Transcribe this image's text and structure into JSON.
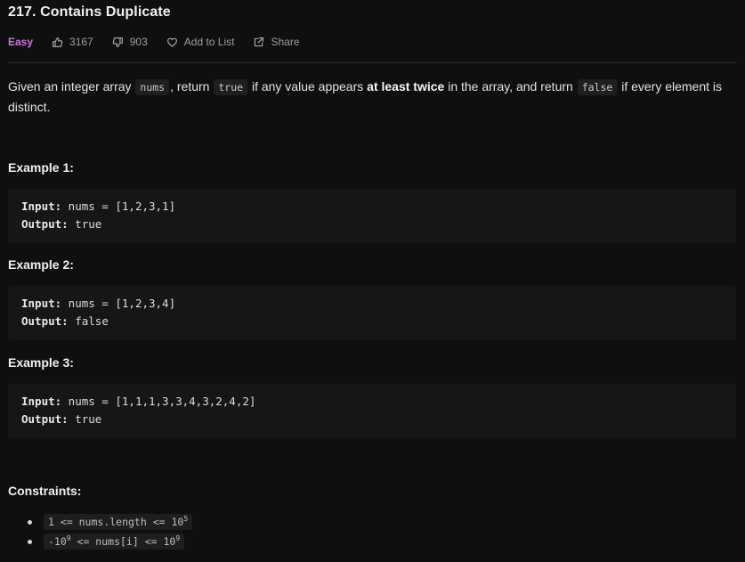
{
  "problem": {
    "title": "217. Contains Duplicate",
    "difficulty": "Easy",
    "likes": "3167",
    "dislikes": "903",
    "add_to_list": "Add to List",
    "share": "Share"
  },
  "description": {
    "p1": "Given an integer array ",
    "code_nums": "nums",
    "p2": ", return ",
    "code_true": "true",
    "p3": " if any value appears ",
    "bold": "at least twice",
    "p4": " in the array, and return ",
    "code_false": "false",
    "p5": " if every element is distinct."
  },
  "examples": [
    {
      "heading": "Example 1:",
      "input_label": "Input:",
      "input": " nums = [1,2,3,1]",
      "output_label": "Output:",
      "output": " true"
    },
    {
      "heading": "Example 2:",
      "input_label": "Input:",
      "input": " nums = [1,2,3,4]",
      "output_label": "Output:",
      "output": " false"
    },
    {
      "heading": "Example 3:",
      "input_label": "Input:",
      "input": " nums = [1,1,1,3,3,4,3,2,4,2]",
      "output_label": "Output:",
      "output": " true"
    }
  ],
  "constraints": {
    "heading": "Constraints:",
    "c1_a": "1 <= nums.length <= 10",
    "c1_exp": "5",
    "c2_a": "-10",
    "c2_exp1": "9",
    "c2_b": " <= nums[i] <= 10",
    "c2_exp2": "9"
  },
  "colors": {
    "background": "#0f0f0f",
    "difficulty_easy": "#c778d6",
    "code_block_bg": "#161616"
  },
  "icons": [
    "thumbs-up-icon",
    "thumbs-down-icon",
    "heart-icon",
    "share-icon"
  ]
}
